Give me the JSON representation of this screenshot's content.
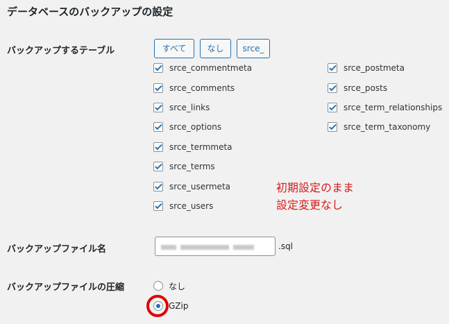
{
  "section": {
    "title": "データベースのバックアップの設定"
  },
  "tables": {
    "label": "バックアップするテーブル",
    "buttons": [
      "すべて",
      "なし",
      "srce_"
    ],
    "left_column": [
      "srce_commentmeta",
      "srce_comments",
      "srce_links",
      "srce_options",
      "srce_termmeta",
      "srce_terms",
      "srce_usermeta",
      "srce_users"
    ],
    "right_column": [
      "srce_postmeta",
      "srce_posts",
      "srce_term_relationships",
      "srce_term_taxonomy"
    ]
  },
  "annotation": {
    "line1": "初期設定のまま",
    "line2": "設定変更なし",
    "color": "#d91a1a"
  },
  "filename": {
    "label": "バックアップファイル名",
    "extension": ".sql"
  },
  "compression": {
    "label": "バックアップファイルの圧縮",
    "options": [
      "なし",
      "GZip"
    ],
    "selected": "GZip"
  },
  "colors": {
    "accent": "#2271b1",
    "highlight": "#e00000",
    "background": "#f1f1f1"
  }
}
